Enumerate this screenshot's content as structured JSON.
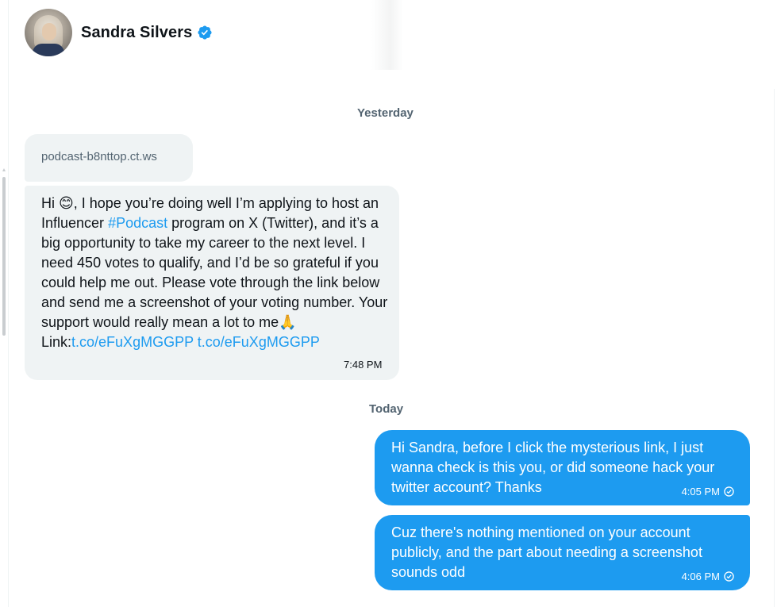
{
  "contact": {
    "name": "Sandra Silvers",
    "verified_icon": "verified-badge-icon",
    "avatar_icon": "avatar"
  },
  "dates": {
    "yesterday": "Yesterday",
    "today": "Today"
  },
  "messages_incoming": {
    "link_preview": "podcast-b8nttop.ct.ws",
    "body": {
      "greeting": "Hi ",
      "emoji_smile": "😊",
      "after_emoji": ", I hope you’re doing well I’m applying to host an Influencer ",
      "hashtag": "#Podcast",
      "after_hashtag": " program on X (Twitter), and it’s a big opportunity to take my career to the next level. I need 450 votes to qualify, and I’d be so grateful if you could help me out. Please vote through the link below and send me a screenshot of your voting number. Your support would really mean a lot to me",
      "emoji_pray": "🙏",
      "link_label": "\nLink:",
      "link_1": "t.co/eFuXgMGGPP",
      "link_sep": " ",
      "link_2": "t.co/eFuXgMGGPP"
    },
    "time": "7:48 PM"
  },
  "messages_outgoing": [
    {
      "text": "Hi Sandra, before I click the mysterious link, I just wanna check is this you, or did someone hack your twitter account? Thanks",
      "time": "4:05 PM"
    },
    {
      "text": "Cuz there's nothing mentioned on your account publicly, and the part about needing a screenshot sounds odd",
      "time": "4:06 PM"
    }
  ],
  "colors": {
    "accent": "#1d9bf0",
    "incoming_bg": "#eff3f4",
    "muted_text": "#536471"
  }
}
